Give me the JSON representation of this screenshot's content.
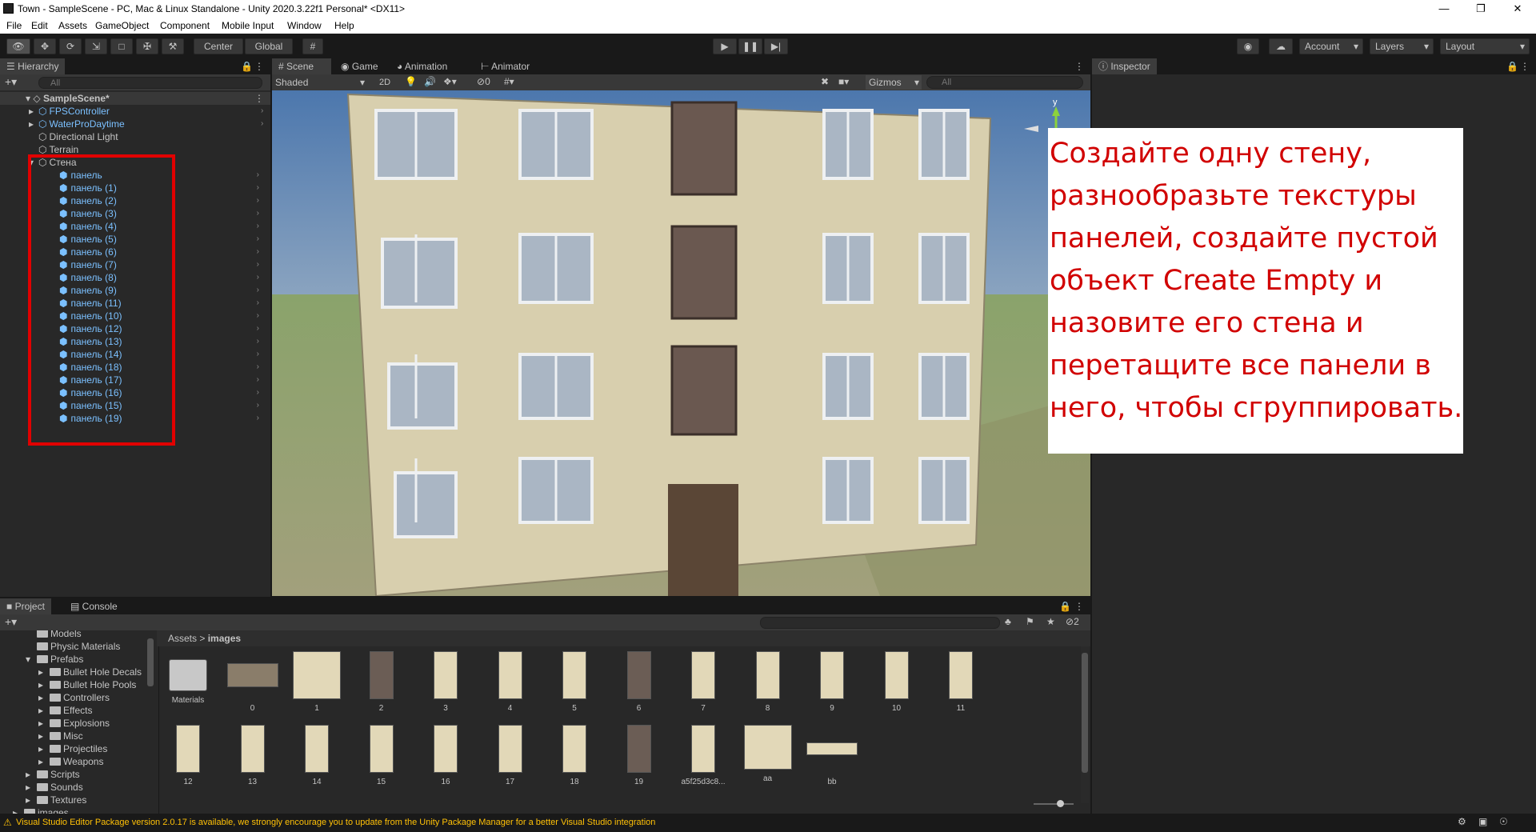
{
  "window": {
    "title": "Town - SampleScene - PC, Mac & Linux Standalone - Unity 2020.3.22f1 Personal* <DX11>"
  },
  "menu": [
    "File",
    "Edit",
    "Assets",
    "GameObject",
    "Component",
    "Mobile Input",
    "Window",
    "Help"
  ],
  "toolbar": {
    "center": "Center",
    "global": "Global",
    "account": "Account",
    "layers": "Layers",
    "layout": "Layout"
  },
  "hierarchy": {
    "tab": "Hierarchy",
    "search_placeholder": "All",
    "scene": "SampleScene*",
    "roots": [
      "FPSController",
      "WaterProDaytime",
      "Directional Light",
      "Terrain",
      "Стена"
    ],
    "children": [
      "панель",
      "панель (1)",
      "панель (2)",
      "панель (3)",
      "панель (4)",
      "панель (5)",
      "панель (6)",
      "панель (7)",
      "панель (8)",
      "панель (9)",
      "панель (11)",
      "панель (10)",
      "панель (12)",
      "панель (13)",
      "панель (14)",
      "панель (18)",
      "панель (17)",
      "панель (16)",
      "панель (15)",
      "панель (19)"
    ]
  },
  "scene_tabs": {
    "scene": "Scene",
    "game": "Game",
    "animation": "Animation",
    "animator": "Animator"
  },
  "scene_bar": {
    "shaded": "Shaded",
    "mode2d": "2D",
    "hidden_count": "0",
    "gizmos": "Gizmos",
    "search_placeholder": "All"
  },
  "axis": {
    "y": "y"
  },
  "inspector": {
    "tab": "Inspector"
  },
  "overlay_text": [
    "Создайте одну стену,",
    "разнообразьте текстуры",
    "панелей, создайте пустой",
    "объект Create Empty и",
    "назовите его стена и",
    "перетащите все панели в",
    "него, чтобы сгруппировать."
  ],
  "project": {
    "tab_project": "Project",
    "tab_console": "Console",
    "crumb_root": "Assets",
    "crumb_sep": ">",
    "crumb_folder": "images",
    "hidden_count": "2",
    "tree": [
      {
        "label": "Models",
        "indent": 0,
        "fold": false
      },
      {
        "label": "Physic Materials",
        "indent": 0,
        "fold": false
      },
      {
        "label": "Prefabs",
        "indent": 0,
        "fold": true
      },
      {
        "label": "Bullet Hole Decals",
        "indent": 1,
        "fold": false
      },
      {
        "label": "Bullet Hole Pools",
        "indent": 1,
        "fold": false
      },
      {
        "label": "Controllers",
        "indent": 1,
        "fold": false
      },
      {
        "label": "Effects",
        "indent": 1,
        "fold": false
      },
      {
        "label": "Explosions",
        "indent": 1,
        "fold": false
      },
      {
        "label": "Misc",
        "indent": 1,
        "fold": false
      },
      {
        "label": "Projectiles",
        "indent": 1,
        "fold": false
      },
      {
        "label": "Weapons",
        "indent": 1,
        "fold": false
      },
      {
        "label": "Scripts",
        "indent": -1,
        "fold": false
      },
      {
        "label": "Sounds",
        "indent": -1,
        "fold": false
      },
      {
        "label": "Textures",
        "indent": -1,
        "fold": false
      },
      {
        "label": "images",
        "indent": -2,
        "fold": false
      }
    ],
    "assets": [
      "Materials",
      "0",
      "1",
      "2",
      "3",
      "4",
      "5",
      "6",
      "7",
      "8",
      "9",
      "10",
      "11",
      "12",
      "13",
      "14",
      "15",
      "16",
      "17",
      "18",
      "19",
      "a5f25d3c8...",
      "aa",
      "bb"
    ]
  },
  "status": {
    "message": "Visual Studio Editor Package version 2.0.17 is available, we strongly encourage you to update from the Unity Package Manager for a better Visual Studio integration"
  }
}
